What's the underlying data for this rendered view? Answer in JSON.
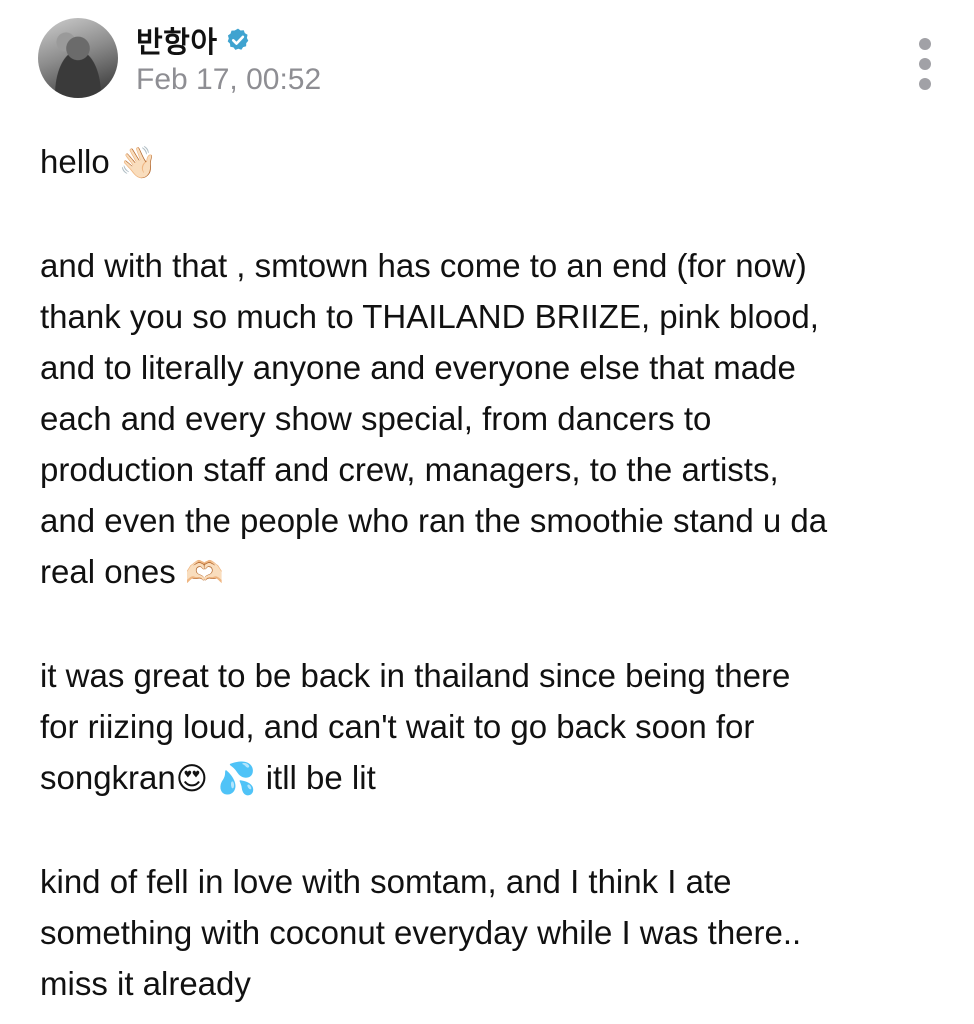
{
  "post": {
    "author": {
      "name": "반항아",
      "verified_icon": "verified-badge-icon",
      "verified_color": "#3fa3d0"
    },
    "timestamp": "Feb 17, 00:52",
    "more_icon": "more-vertical-icon",
    "paragraphs": [
      {
        "lines": [
          {
            "text": "hello ",
            "emoji": "👋🏻"
          }
        ]
      },
      {
        "lines": [
          {
            "text": "and with that , smtown has come to an end (for now)"
          },
          {
            "text": "thank you so much to THAILAND BRIIZE, pink blood,"
          },
          {
            "text": "and to literally anyone and everyone else that made"
          },
          {
            "text": "each and every show special, from dancers to"
          },
          {
            "text": "production staff and crew, managers, to the artists,"
          },
          {
            "text": "and even the people who ran the smoothie stand u da"
          },
          {
            "text": "real ones ",
            "emoji": "🫶🏻"
          }
        ]
      },
      {
        "lines": [
          {
            "text": "it was great to be back in thailand since being there"
          },
          {
            "text": "for riizing loud, and can't wait to go back soon for"
          },
          {
            "text": "songkran",
            "emoji": "😍 💦",
            "tail": " itll be lit"
          }
        ]
      },
      {
        "lines": [
          {
            "text": "kind of fell in love with somtam, and I think I ate"
          },
          {
            "text": "something with coconut everyday while I was there.."
          },
          {
            "text": "miss it already"
          }
        ]
      }
    ]
  }
}
